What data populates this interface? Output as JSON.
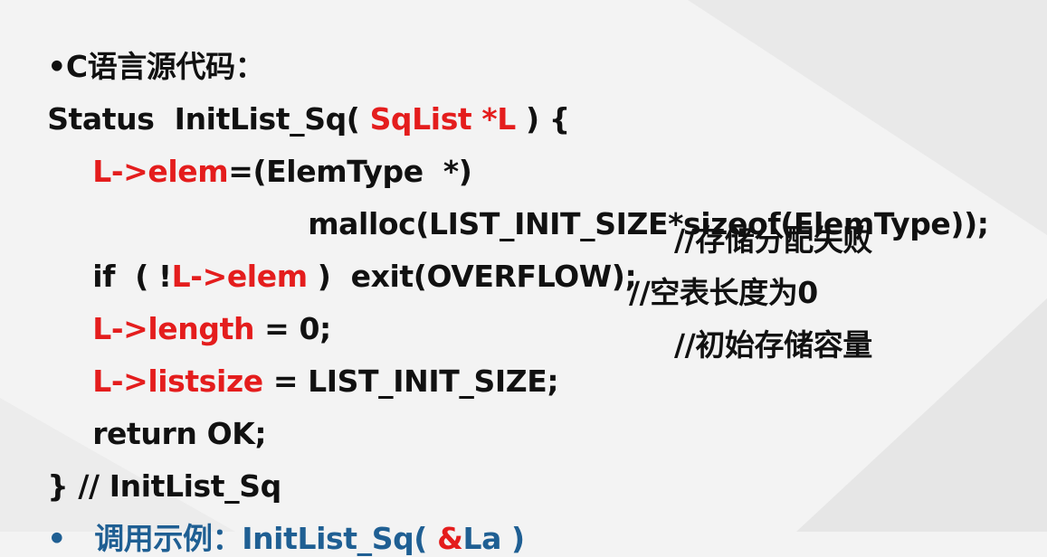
{
  "colors": {
    "text": "#111111",
    "highlight": "#e41d1d",
    "example": "#1f5f93"
  },
  "header": {
    "bullet": "•",
    "title": "C语言源代码："
  },
  "code": {
    "l1_a": "Status  InitList_Sq( ",
    "l1_b": "SqList *L",
    "l1_c": " ) {",
    "l2_a": "L->elem",
    "l2_b": "=(ElemType  *)",
    "l3": "malloc(LIST_INIT_SIZE*sizeof(ElemType));",
    "l4_a": "if  ( !",
    "l4_b": "L->elem",
    "l4_c": " )  exit(OVERFLOW);",
    "l4_comment": "//存储分配失败",
    "l5_a": "L->length",
    "l5_b": " = 0;",
    "l5_comment": "//空表长度为0",
    "l6_a": "L->listsize",
    "l6_b": " = LIST_INIT_SIZE;",
    "l6_comment": "//初始存储容量",
    "l7": "return OK;",
    "l8": "} // InitList_Sq"
  },
  "example": {
    "bullet": "•",
    "label": "调用示例：",
    "call_a": "InitList_Sq( ",
    "call_b": "&",
    "call_c": "La )"
  }
}
